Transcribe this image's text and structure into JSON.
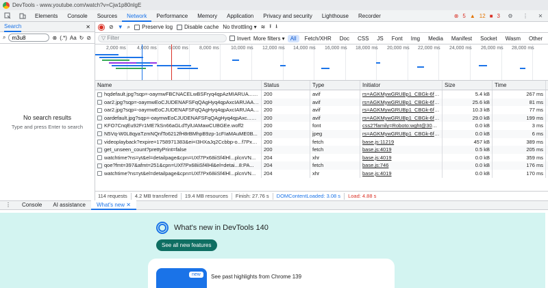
{
  "window": {
    "title": "DevTools - www.youtube.com/watch?v=Cjw1p80nlgE"
  },
  "tabs": [
    {
      "label": "Elements"
    },
    {
      "label": "Console"
    },
    {
      "label": "Sources"
    },
    {
      "label": "Network",
      "active": true
    },
    {
      "label": "Performance"
    },
    {
      "label": "Memory"
    },
    {
      "label": "Application"
    },
    {
      "label": "Privacy and security"
    },
    {
      "label": "Lighthouse"
    },
    {
      "label": "Recorder"
    }
  ],
  "badges": {
    "errors": "5",
    "warnings": "12",
    "issues": "3"
  },
  "search": {
    "title": "Search",
    "query": "m3u8",
    "regex_label": "(.*)",
    "case_label": "Aa",
    "empty_title": "No search results",
    "empty_hint": "Type and press Enter to search"
  },
  "network_toolbar": {
    "preserve_log": "Preserve log",
    "disable_cache": "Disable cache",
    "throttling": "No throttling",
    "filter_placeholder": "Filter",
    "invert": "Invert",
    "more_filters": "More filters",
    "chips": [
      "All",
      "Fetch/XHR",
      "Doc",
      "CSS",
      "JS",
      "Font",
      "Img",
      "Media",
      "Manifest",
      "Socket",
      "Wasm",
      "Other"
    ]
  },
  "timeline": {
    "ticks": [
      "2,000 ms",
      "4,000 ms",
      "6,000 ms",
      "8,000 ms",
      "10,000 ms",
      "12,000 ms",
      "14,000 ms",
      "16,000 ms",
      "18,000 ms",
      "20,000 ms",
      "22,000 ms",
      "24,000 ms",
      "26,000 ms",
      "28,000 ms"
    ]
  },
  "table": {
    "headers": {
      "name": "Name",
      "status": "Status",
      "type": "Type",
      "initiator": "Initiator",
      "size": "Size",
      "time": "Time"
    },
    "rows": [
      {
        "name": "hqdefault.jpg?sqp=-oaymwFBCNACELwBSFryq4qpAzMIARUA...H8...",
        "status": "200",
        "type": "avif",
        "initiator": "rs=AGKMywGRUBp1_CBGk-6fSyour",
        "size": "5.4 kB",
        "time": "267 ms"
      },
      {
        "name": "oar2.jpg?sqp=-oaymwEoCJUDENAFSFqQAgHyq4qpAxcIARUAA......",
        "status": "200",
        "type": "avif",
        "initiator": "rs=AGKMywGRUBp1_CBGk-6fSyour",
        "size": "25.6 kB",
        "time": "81 ms"
      },
      {
        "name": "oar2.jpg?sqp=-oaymwEoCJUDENAFSFqQAgHyq4qpAxcIARUAA......",
        "status": "200",
        "type": "avif",
        "initiator": "rs=AGKMywGRUBp1_CBGk-6fSyour",
        "size": "10.3 kB",
        "time": "77 ms"
      },
      {
        "name": "oardefault.jpg?sqp=-oaymwEoCJUDENAFSFqQAgHyq4qpAxc...hg...",
        "status": "200",
        "type": "avif",
        "initiator": "rs=AGKMywGRUBp1_CBGk-6fSyour",
        "size": "29.0 kB",
        "time": "199 ms"
      },
      {
        "name": "KFO7CnqEu92Fr1ME7kSn66aGLdTylUAMawCUBGEe.woff2",
        "status": "200",
        "type": "font",
        "initiator": "css2?family=Roboto:wght@300;400",
        "size": "0.0 kB",
        "time": "3 ms"
      },
      {
        "name": "N5Vq-W0L8qyaTzmNQnfTo6212fH8rBMhpB9zp-1cFIaMAuME0B...",
        "status": "200",
        "type": "jpeg",
        "initiator": "rs=AGKMywGRUBp1_CBGk-6fSyour",
        "size": "0.0 kB",
        "time": "6 ms"
      },
      {
        "name": "videoplayback?expire=1758971383&ei=I3HXaJq2Ccbbp-o...f7Px6...",
        "status": "200",
        "type": "fetch",
        "initiator": "base.js:11219",
        "size": "457 kB",
        "time": "389 ms"
      },
      {
        "name": "get_unseen_count?prettyPrint=false",
        "status": "200",
        "type": "fetch",
        "initiator": "base.js:4019",
        "size": "0.5 kB",
        "time": "205 ms"
      },
      {
        "name": "watchtime?ns=yt&el=detailpage&cpn=UXf7Px68iiSf4lHl...plcnVN...",
        "status": "204",
        "type": "xhr",
        "initiator": "base.js:4019",
        "size": "0.0 kB",
        "time": "359 ms"
      },
      {
        "name": "qoe?fmt=397&afmt=251&cpn=UXf7Px68iiSf4lHl&el=detai...8:PA...",
        "status": "204",
        "type": "fetch",
        "initiator": "base.js:746",
        "size": "0.0 kB",
        "time": "176 ms"
      },
      {
        "name": "watchtime?ns=yt&el=detailpage&cpn=UXf7Px68iiSf4lHl...plcnVN...",
        "status": "204",
        "type": "xhr",
        "initiator": "base.js:4019",
        "size": "0.0 kB",
        "time": "170 ms"
      }
    ]
  },
  "status_bar": {
    "requests": "114 requests",
    "transferred": "4.2 MB transferred",
    "resources": "19.4 MB resources",
    "finish": "Finish: 27.76 s",
    "dcl": "DOMContentLoaded: 3.08 s",
    "load": "Load: 4.88 s"
  },
  "drawer": {
    "tabs": [
      "Console",
      "AI assistance",
      "What's new"
    ],
    "whats_new_title": "What's new in DevTools 140",
    "see_all": "See all new features",
    "badge_new": "new",
    "past_highlights": "See past highlights from Chrome 139"
  },
  "colors": {
    "accent": "#1a73e8",
    "error": "#d93025",
    "warning": "#e37400",
    "whatsnew_bg": "#d3f4f1"
  }
}
